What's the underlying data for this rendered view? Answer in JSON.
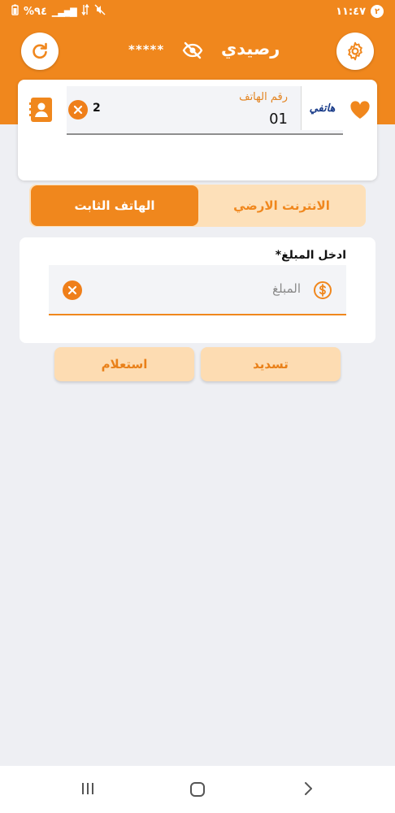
{
  "status_bar": {
    "time": "١١:٤٧",
    "notification_count": "٢",
    "battery": "%٩٤"
  },
  "header": {
    "title": "رصيدي",
    "masked_balance": "*****"
  },
  "phone_card": {
    "provider_logo_text": "هاتفي",
    "phone_label": "رقم الهاتف",
    "phone_value": "01",
    "digit_count": "2"
  },
  "tabs": [
    {
      "label": "الهاتف الثابت",
      "active": true
    },
    {
      "label": "الانترنت الارضي",
      "active": false
    }
  ],
  "amount": {
    "label": "*ادخل المبلغ",
    "placeholder": "المبلغ"
  },
  "actions": {
    "pay_label": "تسديد",
    "query_label": "استعلام"
  },
  "colors": {
    "accent": "#f0871d",
    "accent_light": "#fde0b9",
    "background": "#eeeff3"
  }
}
